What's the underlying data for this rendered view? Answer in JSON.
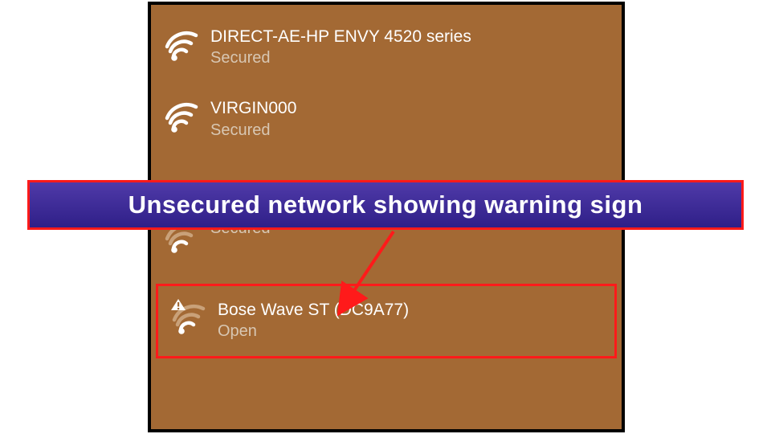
{
  "networks": [
    {
      "name": "DIRECT-AE-HP ENVY 4520 series",
      "status": "Secured",
      "signal": "strong",
      "warning": false
    },
    {
      "name": "VIRGIN000",
      "status": "Secured",
      "signal": "strong",
      "warning": false
    },
    {
      "name": "",
      "status": "Secured",
      "signal": "weak",
      "warning": false
    },
    {
      "name": "Bose Wave ST (DC9A77)",
      "status": "Open",
      "signal": "weak",
      "warning": true
    }
  ],
  "annotation": {
    "label": "Unsecured network showing warning sign"
  },
  "colors": {
    "panel_bg": "#a36934",
    "highlight": "#ff1a1a",
    "annotation_bg_top": "#4f3aa8",
    "annotation_bg_bottom": "#2f1f88"
  }
}
